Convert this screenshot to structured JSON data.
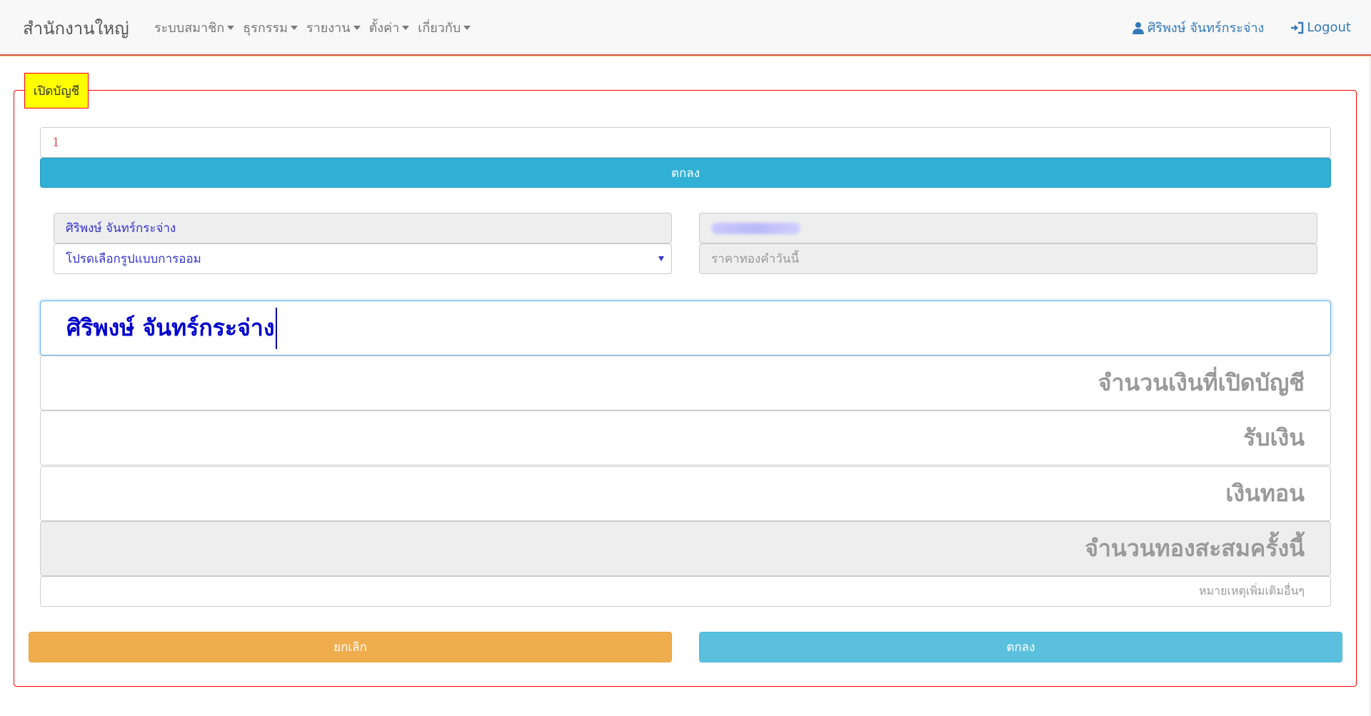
{
  "navbar": {
    "brand": "สำนักงานใหญ่",
    "menu": [
      {
        "label": "ระบบสมาชิก"
      },
      {
        "label": "ธุรกรรม"
      },
      {
        "label": "รายงาน"
      },
      {
        "label": "ตั้งค่า"
      },
      {
        "label": "เกี่ยวกับ"
      }
    ],
    "user_name": "ศิริพงษ์ จันทร์กระจ่าง",
    "logout_label": "Logout"
  },
  "form": {
    "legend": "เปิดบัญชี",
    "search_value": "1",
    "search_button": "ตกลง",
    "member_name": "ศิริพงษ์ จันทร์กระจ่าง",
    "plan_select": {
      "selected": "โปรดเลือกรูปแบบการออม"
    },
    "gold_price_placeholder": "ราคาทองคำวันนี้",
    "name_display": "ศิริพงษ์ จันทร์กระจ่าง",
    "amount_placeholder": "จำนวนเงินที่เปิดบัญชี",
    "received_placeholder": "รับเงิน",
    "change_placeholder": "เงินทอน",
    "gold_accumulated_placeholder": "จำนวนทองสะสมครั้งนี้",
    "note_placeholder": "หมายเหตุเพิ่มเติมอื่นๆ",
    "cancel_button": "ยกเลิก",
    "confirm_button": "ตกลง"
  },
  "colors": {
    "frame_border": "#ff0000",
    "legend_bg": "#ffff00",
    "info_button": "#31b0d5",
    "warning_button": "#f0ad4e",
    "confirm_button": "#5bc0de",
    "link": "#337ab7"
  },
  "icons": {
    "user": "user-icon",
    "logout": "log-in-icon",
    "caret": "caret-down-icon"
  }
}
